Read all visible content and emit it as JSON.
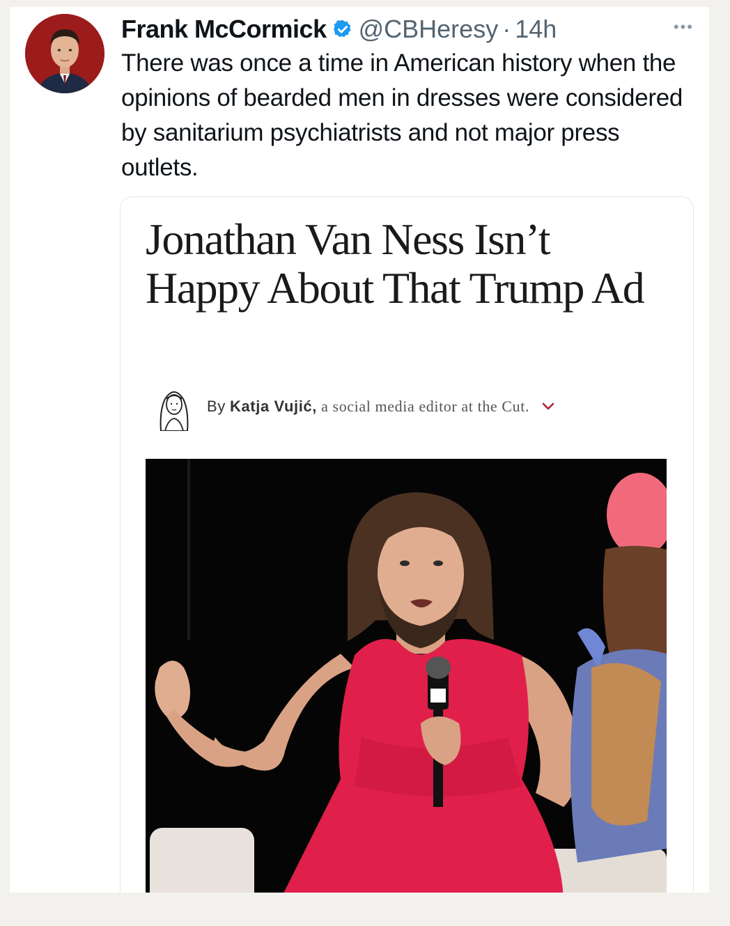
{
  "tweet": {
    "author_name": "Frank McCormick",
    "handle": "@CBHeresy",
    "separator": "·",
    "time": "14h",
    "more_glyph": "•••",
    "text": "There was once a time in American history when the opinions of bearded men in dresses were considered by sanitarium psychiatrists and not major press outlets."
  },
  "card": {
    "headline": "Jonathan Van Ness Isn’t Happy About That Trump Ad",
    "byline_prefix": "By",
    "byline_author": "Katja Vujić,",
    "byline_suffix": "a social media editor at the Cut."
  },
  "colors": {
    "avatar_background": "#9c1b1b",
    "verified_badge": "#1d9bf0",
    "chevron_accent": "#b0203a",
    "dress": "#e0204a"
  },
  "icons": {
    "verified": "verified-badge-icon",
    "more": "more-options-icon",
    "chevron": "chevron-down-icon"
  }
}
